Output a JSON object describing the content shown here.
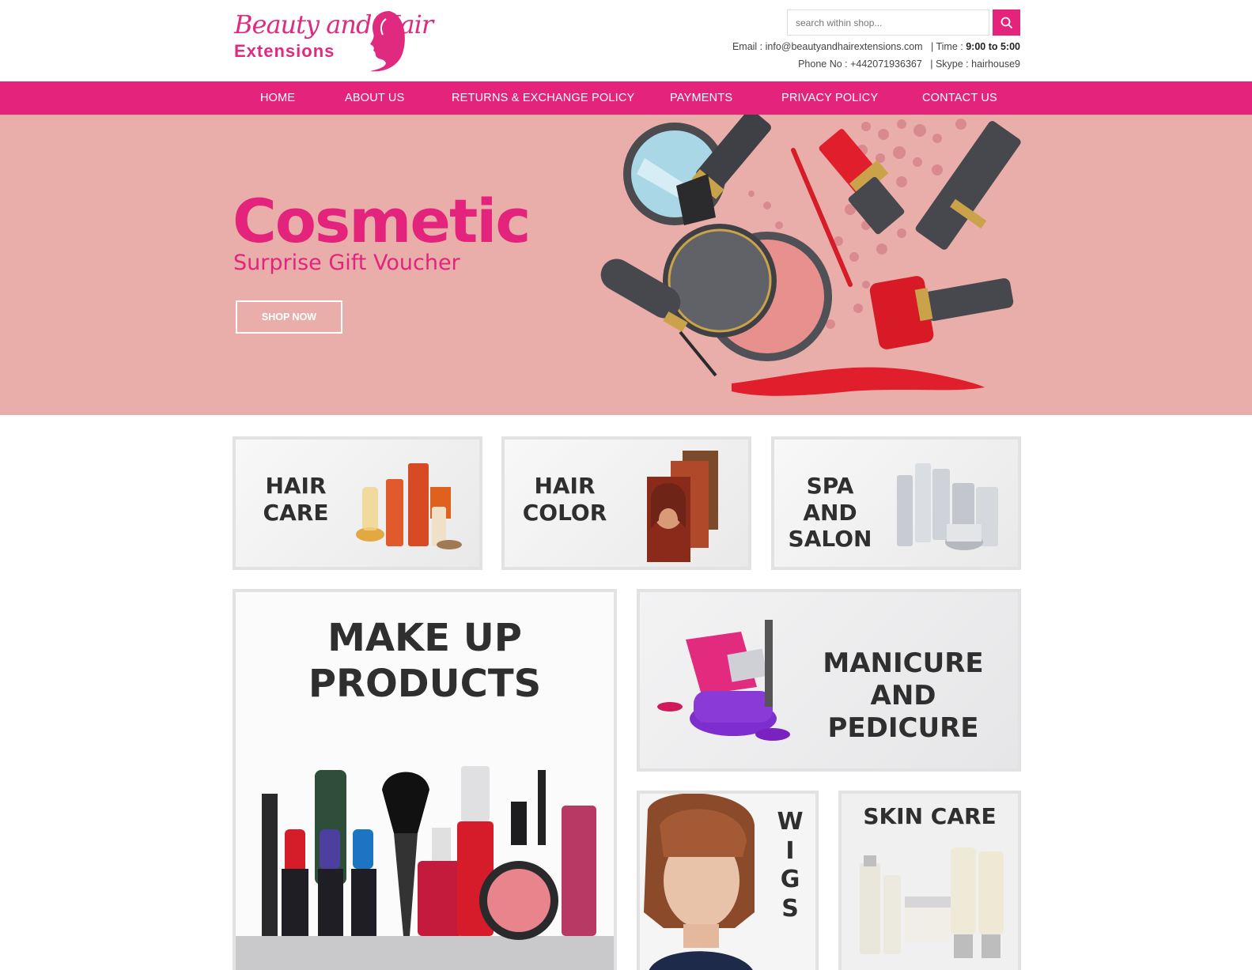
{
  "brand": {
    "logo_line1": "Beauty and Hair",
    "logo_line2": "Extensions"
  },
  "search": {
    "placeholder": "search within shop..."
  },
  "contact": {
    "email_label": "Email : ",
    "email": "info@beautyandhairextensions.com",
    "time_label": "|  Time : ",
    "time": "9:00 to 5:00",
    "phone_label": "Phone No : ",
    "phone": "+442071936367",
    "skype_label": "|  Skype : ",
    "skype": "hairhouse9"
  },
  "nav": {
    "items": [
      {
        "label": "HOME"
      },
      {
        "label": "ABOUT US"
      },
      {
        "label": "RETURNS & EXCHANGE POLICY"
      },
      {
        "label": "PAYMENTS"
      },
      {
        "label": "PRIVACY POLICY"
      },
      {
        "label": "CONTACT US"
      }
    ]
  },
  "banner": {
    "title": "Cosmetic",
    "subtitle": "Surprise Gift Voucher",
    "cta": "SHOP NOW"
  },
  "categories": {
    "hair_care": [
      "HAIR",
      "CARE"
    ],
    "hair_color": [
      "HAIR",
      "COLOR"
    ],
    "spa_salon": [
      "SPA AND",
      "SALON"
    ],
    "makeup": [
      "MAKE UP",
      "PRODUCTS"
    ],
    "manicure": [
      "MANICURE AND",
      "PEDICURE"
    ],
    "wigs": [
      "W",
      "I",
      "G",
      "S"
    ],
    "skin_care": [
      "SKIN CARE"
    ]
  },
  "colors": {
    "accent": "#e3237c",
    "banner_bg": "#e9aeaa",
    "tile_border": "#e2e2e2",
    "tile_text": "#2f2f2f"
  }
}
